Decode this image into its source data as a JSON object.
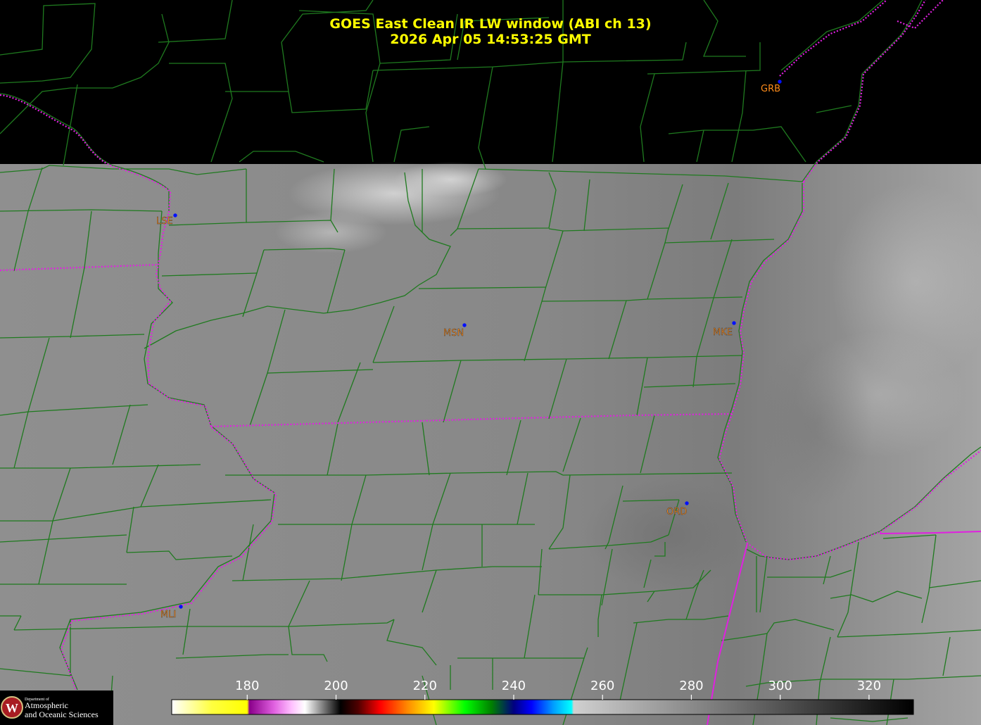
{
  "title": {
    "line1": "GOES East Clean IR LW window (ABI ch 13)",
    "line2": "2026 Apr 05  14:53:25 GMT"
  },
  "colors": {
    "background": "#000000",
    "county_lines": "#1f7a1f",
    "state_lines": "#e020e0",
    "station_dot": "#0010ff",
    "station_label": "#ff8c1a",
    "title_text": "#ffff00"
  },
  "stations": [
    {
      "code": "GRB",
      "name": "grb"
    },
    {
      "code": "LSE",
      "name": "lse"
    },
    {
      "code": "MSN",
      "name": "msn"
    },
    {
      "code": "MKE",
      "name": "mke"
    },
    {
      "code": "ORD",
      "name": "ord"
    },
    {
      "code": "MLI",
      "name": "mli"
    }
  ],
  "colorbar": {
    "ticks": [
      "180",
      "200",
      "220",
      "240",
      "260",
      "280",
      "300",
      "320"
    ],
    "stops": [
      {
        "value": 163,
        "color": "#ffffff"
      },
      {
        "value": 172,
        "color": "#ffff40"
      },
      {
        "value": 180,
        "color": "#ffff00"
      },
      {
        "value": 180.5,
        "color": "#8a008a"
      },
      {
        "value": 186,
        "color": "#e060e0"
      },
      {
        "value": 190,
        "color": "#ffc0ff"
      },
      {
        "value": 193,
        "color": "#ffffff"
      },
      {
        "value": 197,
        "color": "#808080"
      },
      {
        "value": 201,
        "color": "#000000"
      },
      {
        "value": 205,
        "color": "#500000"
      },
      {
        "value": 210,
        "color": "#ff0000"
      },
      {
        "value": 216,
        "color": "#ff8800"
      },
      {
        "value": 222,
        "color": "#ffff00"
      },
      {
        "value": 229,
        "color": "#00ff00"
      },
      {
        "value": 235,
        "color": "#008000"
      },
      {
        "value": 240,
        "color": "#000080"
      },
      {
        "value": 244,
        "color": "#0000ff"
      },
      {
        "value": 249,
        "color": "#00a0ff"
      },
      {
        "value": 253,
        "color": "#00ffff"
      },
      {
        "value": 253.5,
        "color": "#d0d0d0"
      },
      {
        "value": 290,
        "color": "#707070"
      },
      {
        "value": 330,
        "color": "#000000"
      }
    ]
  },
  "logo": {
    "line1": "Department of",
    "line2": "Atmospheric",
    "line3": "and Oceanic Sciences",
    "seal_letter": "W"
  }
}
